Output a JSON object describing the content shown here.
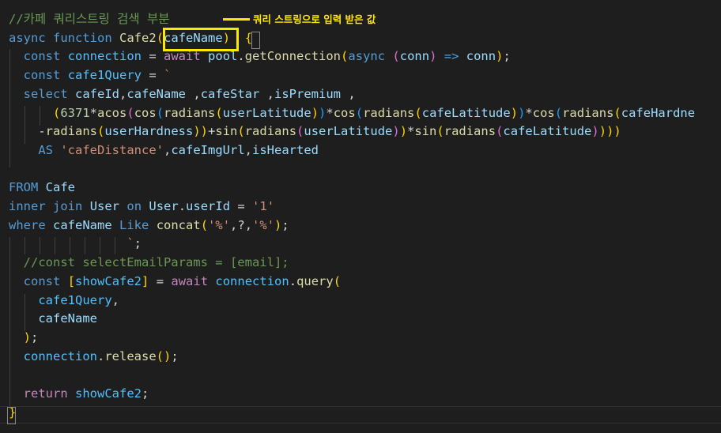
{
  "editor": {
    "lines": [
      "//카페 쿼리스트링 검색 부분",
      "async function Cafe2(cafeName)  {",
      "  const connection = await pool.getConnection(async (conn) => conn);",
      "  const cafe1Query = `",
      "  select cafeId,cafeName ,cafeStar ,isPremium ,",
      "      (6371*acos(cos(radians(userLatitude))*cos(radians(cafeLatitude))*cos(radians(cafeHardne",
      "    -radians(userHardness))+sin(radians(userLatitude))*sin(radians(cafeLatitude))))",
      "    AS 'cafeDistance',cafeImgUrl,isHearted",
      "",
      "FROM Cafe",
      "inner join User on User.userId = '1'",
      "where cafeName Like concat('%',?,'%');",
      "                `;",
      "  //const selectEmailParams = [email];",
      "  const [showCafe2] = await connection.query(",
      "    cafe1Query,",
      "    cafeName",
      "  );",
      "  connection.release();",
      "",
      "  return showCafe2;",
      "}"
    ]
  },
  "annotation": {
    "text": "쿼리 스트링으로 입력 받은 값",
    "color": "#ffe800"
  },
  "theme": {
    "background": "#1e1e1e",
    "keyword": "#569cd6",
    "control": "#c586c0",
    "function": "#dcdcaa",
    "variable": "#9cdcfe",
    "string": "#ce9178",
    "number": "#b5cea8",
    "comment": "#6a9955"
  }
}
